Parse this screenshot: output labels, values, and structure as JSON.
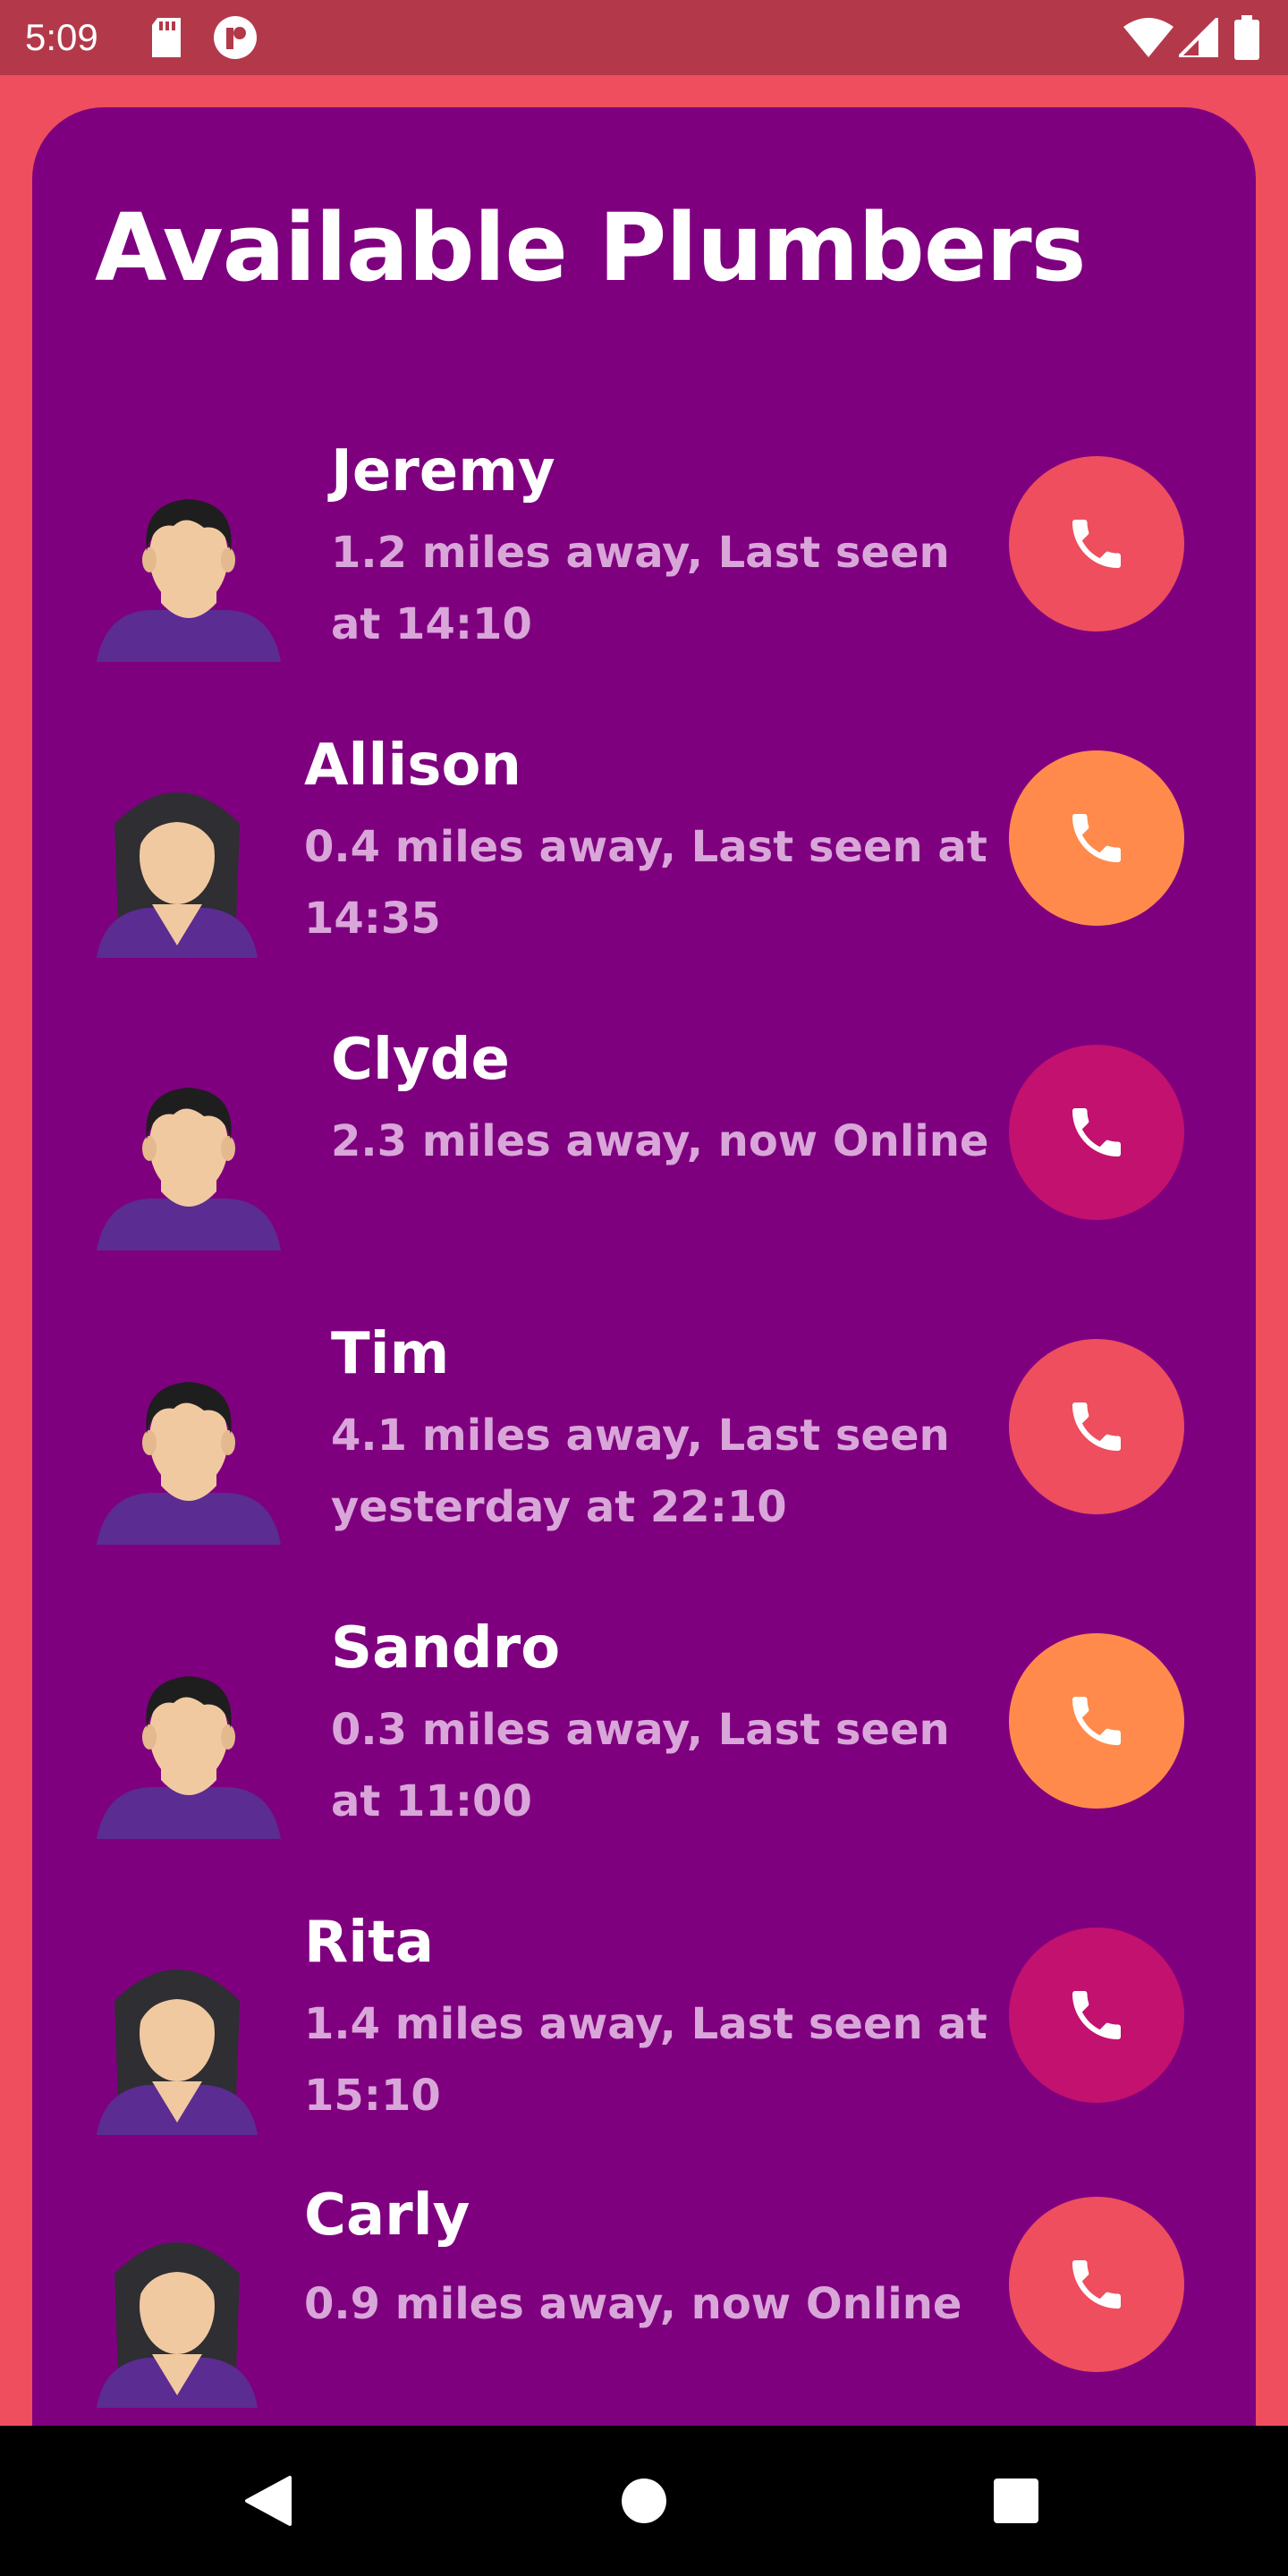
{
  "status_bar": {
    "time": "5:09",
    "left_icons": [
      "sd-card-icon",
      "app-notification-icon"
    ],
    "right_icons": [
      "wifi-icon",
      "cell-signal-icon",
      "battery-icon"
    ]
  },
  "title": "Available Plumbers",
  "plumbers": [
    {
      "name": "Jeremy",
      "status": "1.2 miles away, Last seen at 14:10",
      "gender": "male",
      "call_color": "#EE4E5E"
    },
    {
      "name": "Allison",
      "status": "0.4 miles away, Last seen at 14:35",
      "gender": "female",
      "call_color": "#FF8A4C"
    },
    {
      "name": "Clyde",
      "status": "2.3 miles away, now Online",
      "gender": "male",
      "call_color": "#C2116E"
    },
    {
      "name": "Tim",
      "status": "4.1 miles away, Last seen yesterday at 22:10",
      "gender": "male",
      "call_color": "#EE4E5E"
    },
    {
      "name": "Sandro",
      "status": "0.3 miles away, Last seen at 11:00",
      "gender": "male",
      "call_color": "#FF8A4C"
    },
    {
      "name": "Rita",
      "status": "1.4 miles away, Last seen at 15:10",
      "gender": "female",
      "call_color": "#C2116E"
    },
    {
      "name": "Carly",
      "status": "0.9 miles away, now Online",
      "gender": "female",
      "call_color": "#EE4E5E"
    }
  ],
  "nav_bar": {
    "buttons": [
      "back-icon",
      "home-icon",
      "recents-icon"
    ]
  },
  "colors": {
    "background": "#EE4E5E",
    "status_bar": "#B3394A",
    "card": "#7F007F",
    "subtext": "#D9A6D9"
  }
}
